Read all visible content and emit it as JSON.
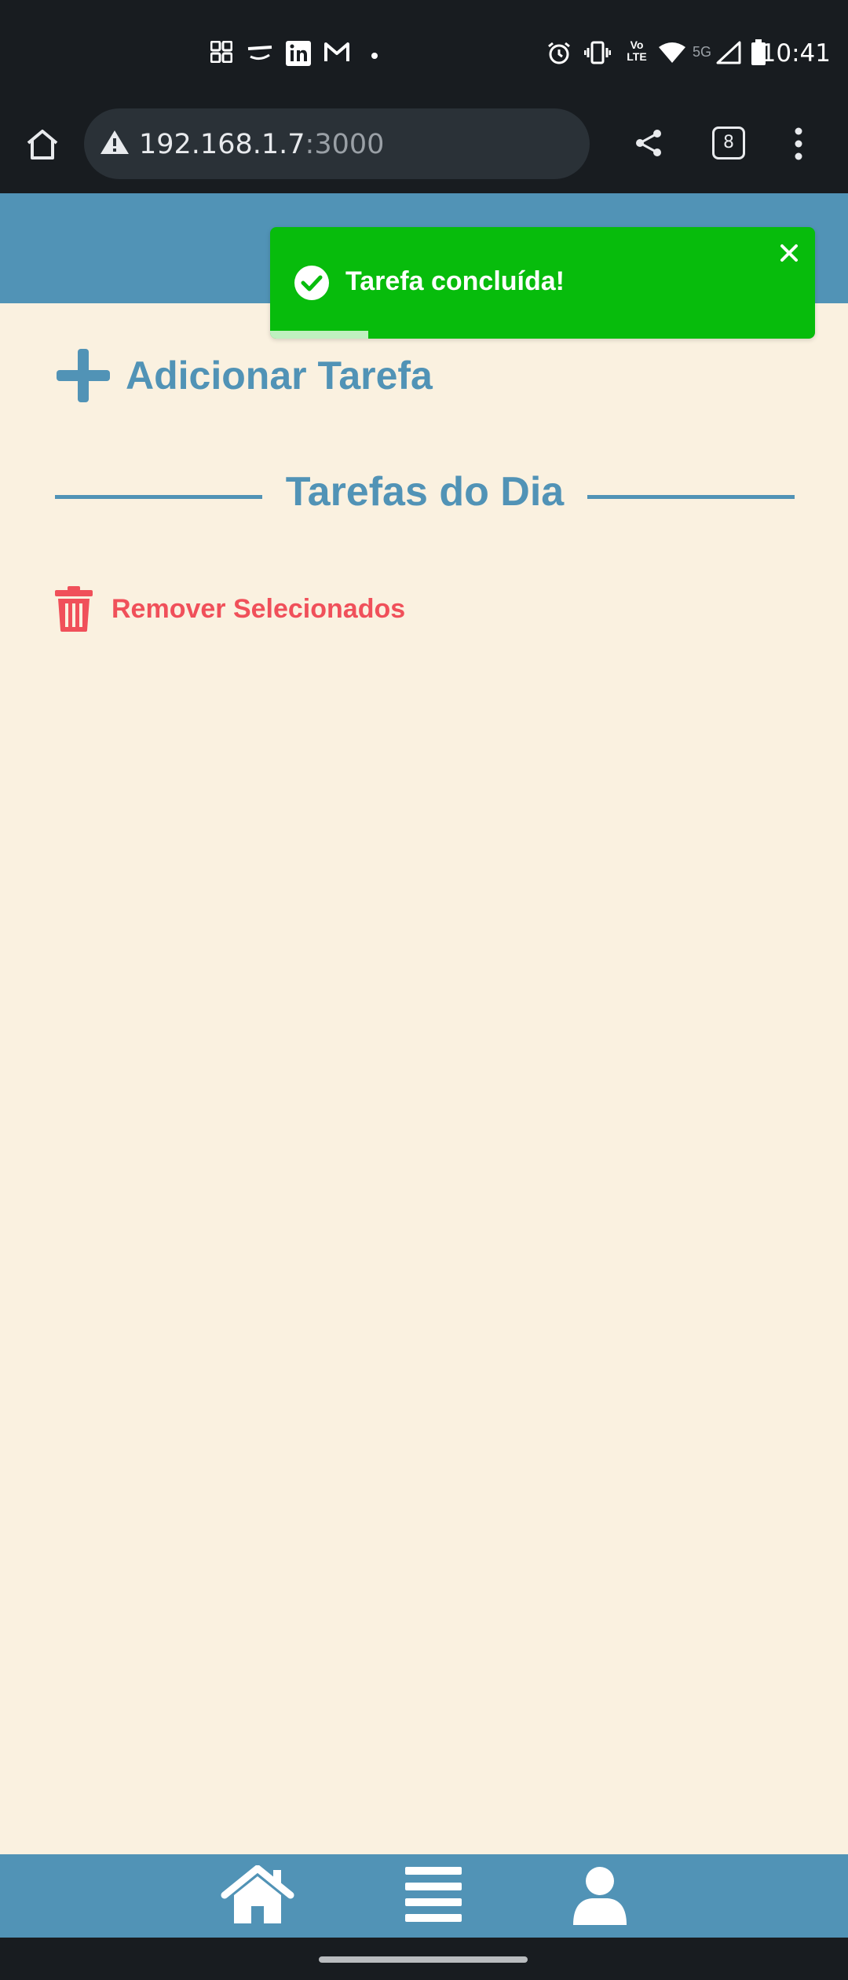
{
  "status_bar": {
    "time": "10:41",
    "network_label": "5G",
    "volte_label": "Vo LTE",
    "left_icons": [
      "grid-apps-icon",
      "ifood-icon",
      "linkedin-icon",
      "gmail-icon",
      "dot-icon"
    ],
    "right_icons": [
      "alarm-icon",
      "vibrate-icon",
      "volte-icon",
      "wifi-icon",
      "signal-icon",
      "battery-icon"
    ]
  },
  "browser": {
    "url_host": "192.168.1.7",
    "url_port": ":3000",
    "tab_count": "8",
    "icons": [
      "home-icon",
      "not-secure-warning-icon",
      "share-icon",
      "tab-switcher-icon",
      "more-options-icon"
    ]
  },
  "toast": {
    "message": "Tarefa concluída!",
    "progress": 0.18,
    "color": "#07bc0c"
  },
  "main": {
    "add_task_label": "Adicionar Tarefa",
    "section_title": "Tarefas do Dia",
    "remove_selected_label": "Remover Selecionados"
  },
  "bottom_nav": {
    "items": [
      "home-icon",
      "menu-icon",
      "user-icon"
    ]
  },
  "colors": {
    "primary": "#5193b6",
    "background": "#faf1e0",
    "danger": "#f0505a",
    "success": "#07bc0c"
  }
}
